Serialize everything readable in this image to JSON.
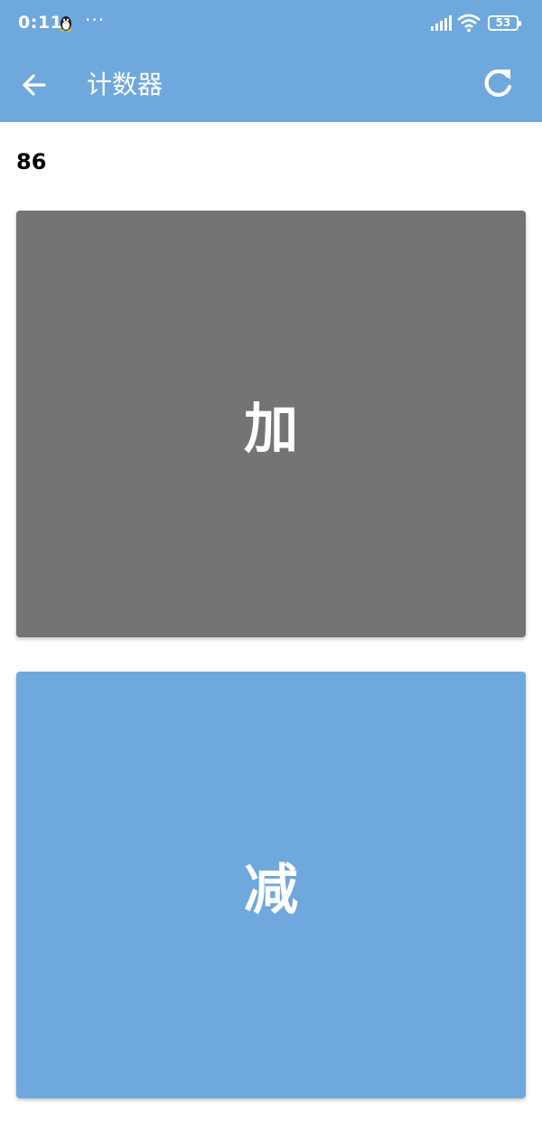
{
  "status_bar": {
    "time": "0:11",
    "more": "···",
    "battery": "53"
  },
  "app_bar": {
    "title": "计数器",
    "back_icon": "arrow-back-icon",
    "refresh_icon": "refresh-icon"
  },
  "counter": {
    "value": "86"
  },
  "buttons": {
    "add_label": "加",
    "subtract_label": "减"
  },
  "colors": {
    "accent": "#6fa8dc",
    "add_button": "#747474",
    "subtract_button": "#6fa8dc"
  }
}
